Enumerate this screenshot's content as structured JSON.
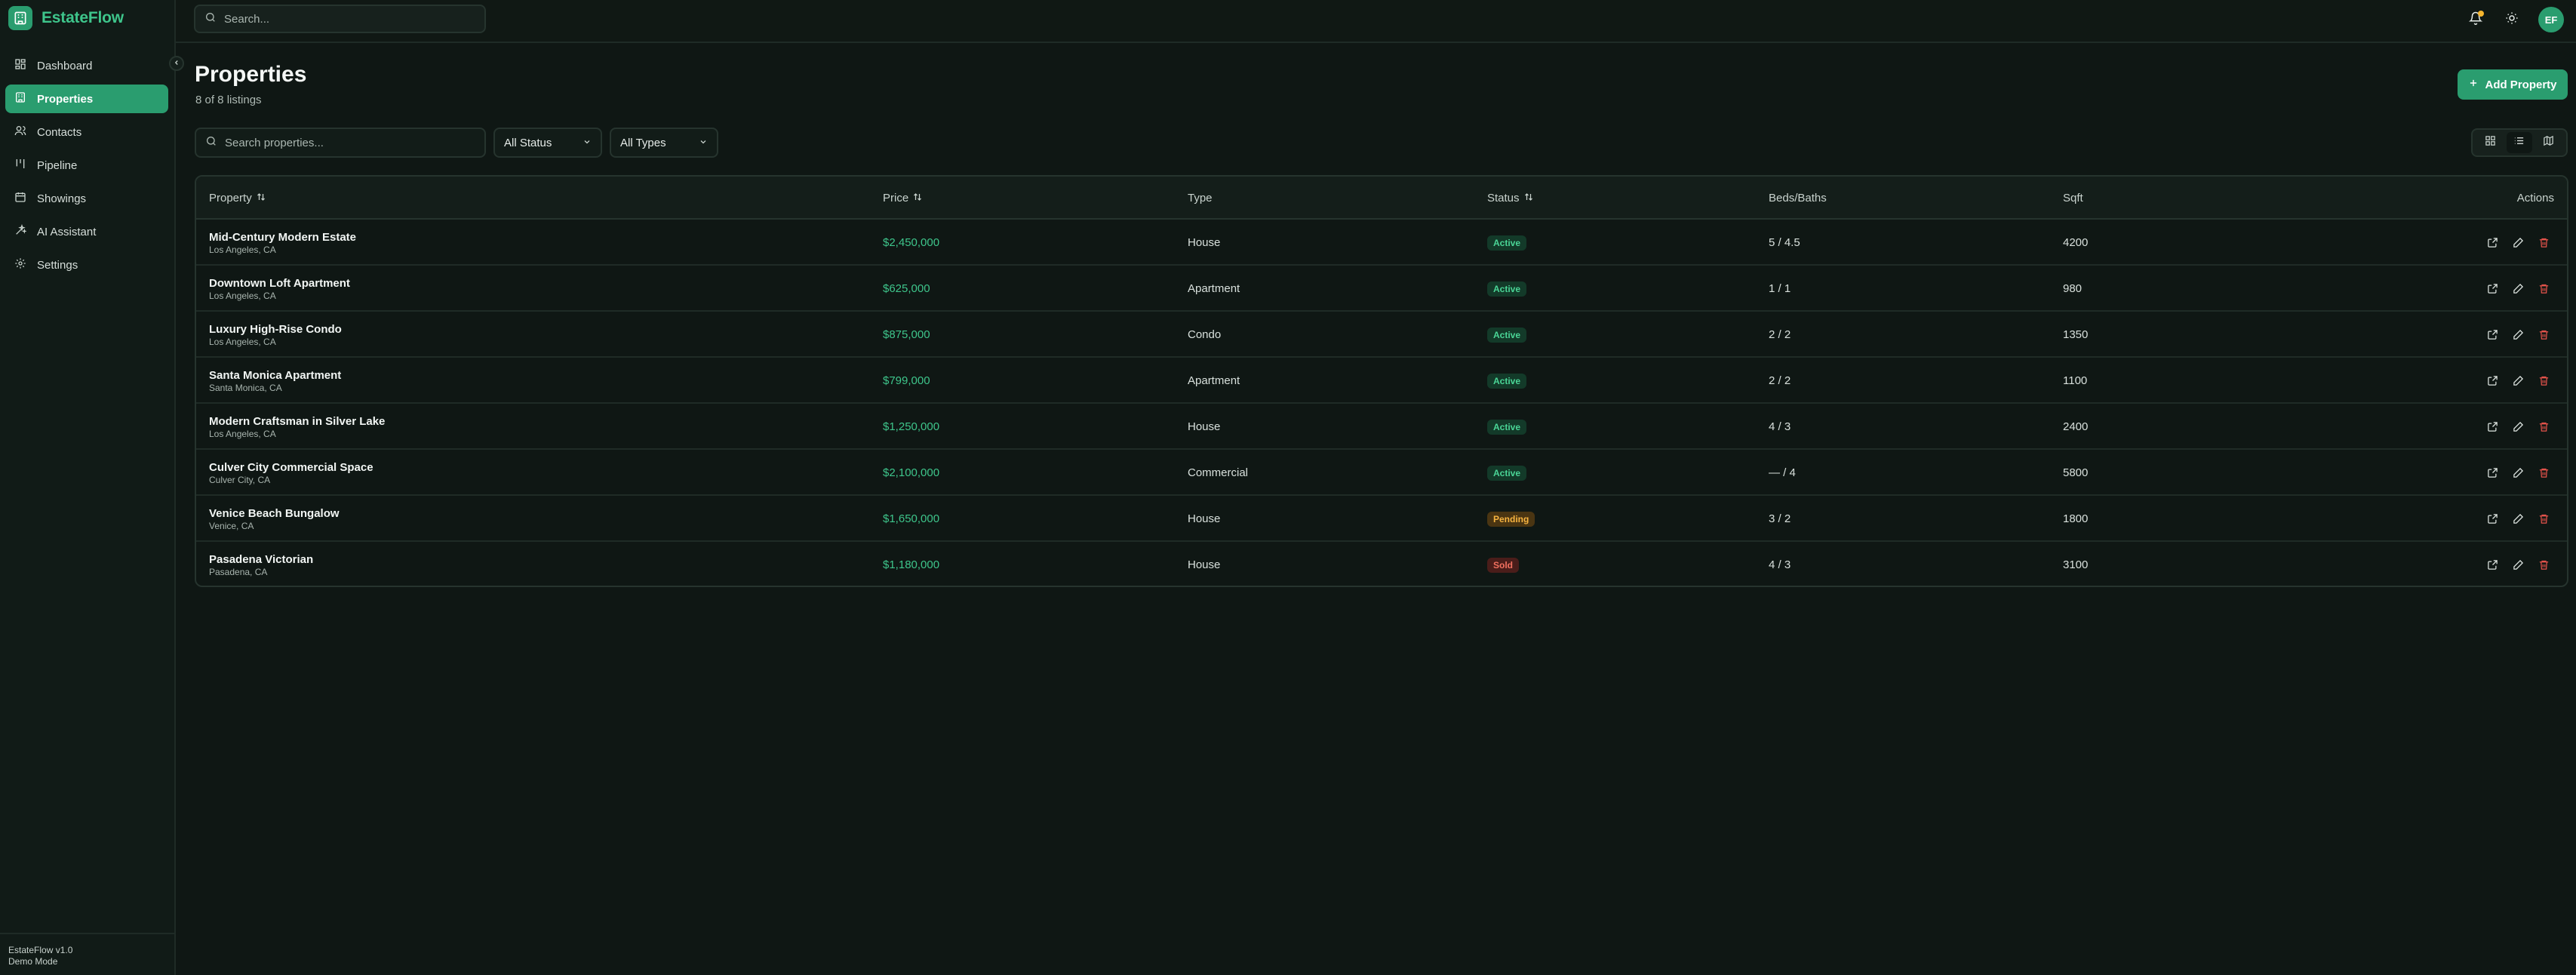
{
  "brand": {
    "name": "EstateFlow"
  },
  "topbar": {
    "search_placeholder": "Search..."
  },
  "user": {
    "initials": "EF"
  },
  "sidebar": {
    "items": [
      {
        "label": "Dashboard",
        "icon": "dashboard-icon"
      },
      {
        "label": "Properties",
        "icon": "building-icon",
        "active": true
      },
      {
        "label": "Contacts",
        "icon": "users-icon"
      },
      {
        "label": "Pipeline",
        "icon": "kanban-icon"
      },
      {
        "label": "Showings",
        "icon": "calendar-icon"
      },
      {
        "label": "AI Assistant",
        "icon": "sparkles-icon"
      },
      {
        "label": "Settings",
        "icon": "gear-icon"
      }
    ],
    "footer": {
      "version": "EstateFlow v1.0",
      "mode": "Demo Mode"
    }
  },
  "page": {
    "title": "Properties",
    "subtitle": "8 of 8 listings",
    "add_button": "Add Property"
  },
  "filters": {
    "search_placeholder": "Search properties...",
    "status": "All Status",
    "type": "All Types"
  },
  "table": {
    "headers": {
      "property": "Property",
      "price": "Price",
      "type": "Type",
      "status": "Status",
      "beds_baths": "Beds/Baths",
      "sqft": "Sqft",
      "actions": "Actions"
    },
    "rows": [
      {
        "name": "Mid-Century Modern Estate",
        "city": "Los Angeles, CA",
        "price": "$2,450,000",
        "type": "House",
        "status": "Active",
        "status_kind": "active",
        "beds_baths": "5 / 4.5",
        "sqft": "4200"
      },
      {
        "name": "Downtown Loft Apartment",
        "city": "Los Angeles, CA",
        "price": "$625,000",
        "type": "Apartment",
        "status": "Active",
        "status_kind": "active",
        "beds_baths": "1 / 1",
        "sqft": "980"
      },
      {
        "name": "Luxury High-Rise Condo",
        "city": "Los Angeles, CA",
        "price": "$875,000",
        "type": "Condo",
        "status": "Active",
        "status_kind": "active",
        "beds_baths": "2 / 2",
        "sqft": "1350"
      },
      {
        "name": "Santa Monica Apartment",
        "city": "Santa Monica, CA",
        "price": "$799,000",
        "type": "Apartment",
        "status": "Active",
        "status_kind": "active",
        "beds_baths": "2 / 2",
        "sqft": "1100"
      },
      {
        "name": "Modern Craftsman in Silver Lake",
        "city": "Los Angeles, CA",
        "price": "$1,250,000",
        "type": "House",
        "status": "Active",
        "status_kind": "active",
        "beds_baths": "4 / 3",
        "sqft": "2400"
      },
      {
        "name": "Culver City Commercial Space",
        "city": "Culver City, CA",
        "price": "$2,100,000",
        "type": "Commercial",
        "status": "Active",
        "status_kind": "active",
        "beds_baths": "— / 4",
        "sqft": "5800"
      },
      {
        "name": "Venice Beach Bungalow",
        "city": "Venice, CA",
        "price": "$1,650,000",
        "type": "House",
        "status": "Pending",
        "status_kind": "pending",
        "beds_baths": "3 / 2",
        "sqft": "1800"
      },
      {
        "name": "Pasadena Victorian",
        "city": "Pasadena, CA",
        "price": "$1,180,000",
        "type": "House",
        "status": "Sold",
        "status_kind": "sold",
        "beds_baths": "4 / 3",
        "sqft": "3100"
      }
    ]
  },
  "colors": {
    "accent": "#2a9d6f",
    "price": "#3ec58b",
    "pending": "#f7b440",
    "sold": "#f2705f",
    "danger": "#e5534b"
  }
}
